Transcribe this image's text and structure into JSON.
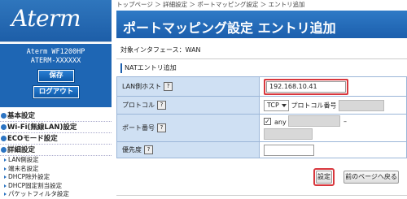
{
  "sidebar": {
    "logo": "Aterm",
    "model_line1": "Aterm WF1200HP",
    "model_line2": "ATERM-XXXXXX",
    "save_label": "保存",
    "logout_label": "ログアウト",
    "menu": [
      {
        "label": "基本設定"
      },
      {
        "label": "Wi-Fi(無線LAN)設定"
      },
      {
        "label": "ECOモード設定"
      },
      {
        "label": "詳細設定"
      }
    ],
    "submenu": [
      {
        "label": "LAN側設定"
      },
      {
        "label": "端末名設定"
      },
      {
        "label": "DHCP除外設定"
      },
      {
        "label": "DHCP固定割当設定"
      },
      {
        "label": "パケットフィルタ設定"
      }
    ]
  },
  "breadcrumb": "トップページ ＞ 詳細設定 ＞ ポートマッピング設定 ＞ エントリ追加",
  "page_title": "ポートマッピング設定 エントリ追加",
  "interface_label": "対象インタフェース：WAN",
  "section_label": "NATエントリ追加",
  "help_mark": "?",
  "form": {
    "lan_host_label": "LAN側ホスト",
    "lan_host_value": "192.168.10.41",
    "protocol_label": "プロトコル",
    "protocol_selected": "TCP",
    "protocol_number_label": "プロトコル番号",
    "port_label": "ポート番号",
    "port_any_label": "any",
    "port_any_checked": "✓",
    "port_separator": "–",
    "priority_label": "優先度",
    "priority_value": ""
  },
  "buttons": {
    "set_label": "設定",
    "back_label": "前のページへ戻る"
  },
  "colors": {
    "header_blue": "#1c5fad",
    "label_bg": "#cfe0f3",
    "highlight_red": "#d8373d"
  }
}
